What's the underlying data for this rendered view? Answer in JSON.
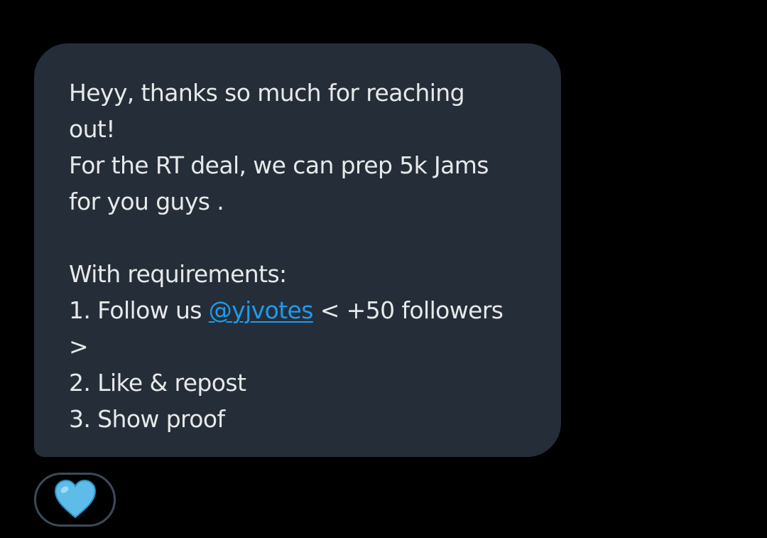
{
  "message": {
    "lines": [
      "Heyy, thanks so much for reaching",
      "out!",
      "For the RT deal, we can prep 5k Jams",
      "for you guys .",
      "",
      "With requirements:"
    ],
    "follow_prefix": "1. Follow us ",
    "mention": "@yjvotes",
    "follow_suffix": " < +50 followers",
    "follow_wrap": ">",
    "req_2": "2. Like & repost",
    "req_3": "3. Show proof"
  },
  "reaction": {
    "icon": "blue-heart-icon",
    "color": "#5dbde8"
  },
  "colors": {
    "background": "#000000",
    "bubble": "#252e38",
    "text": "#e7e9ea",
    "link": "#1d9bf0",
    "reaction_border": "#3d4a58"
  }
}
